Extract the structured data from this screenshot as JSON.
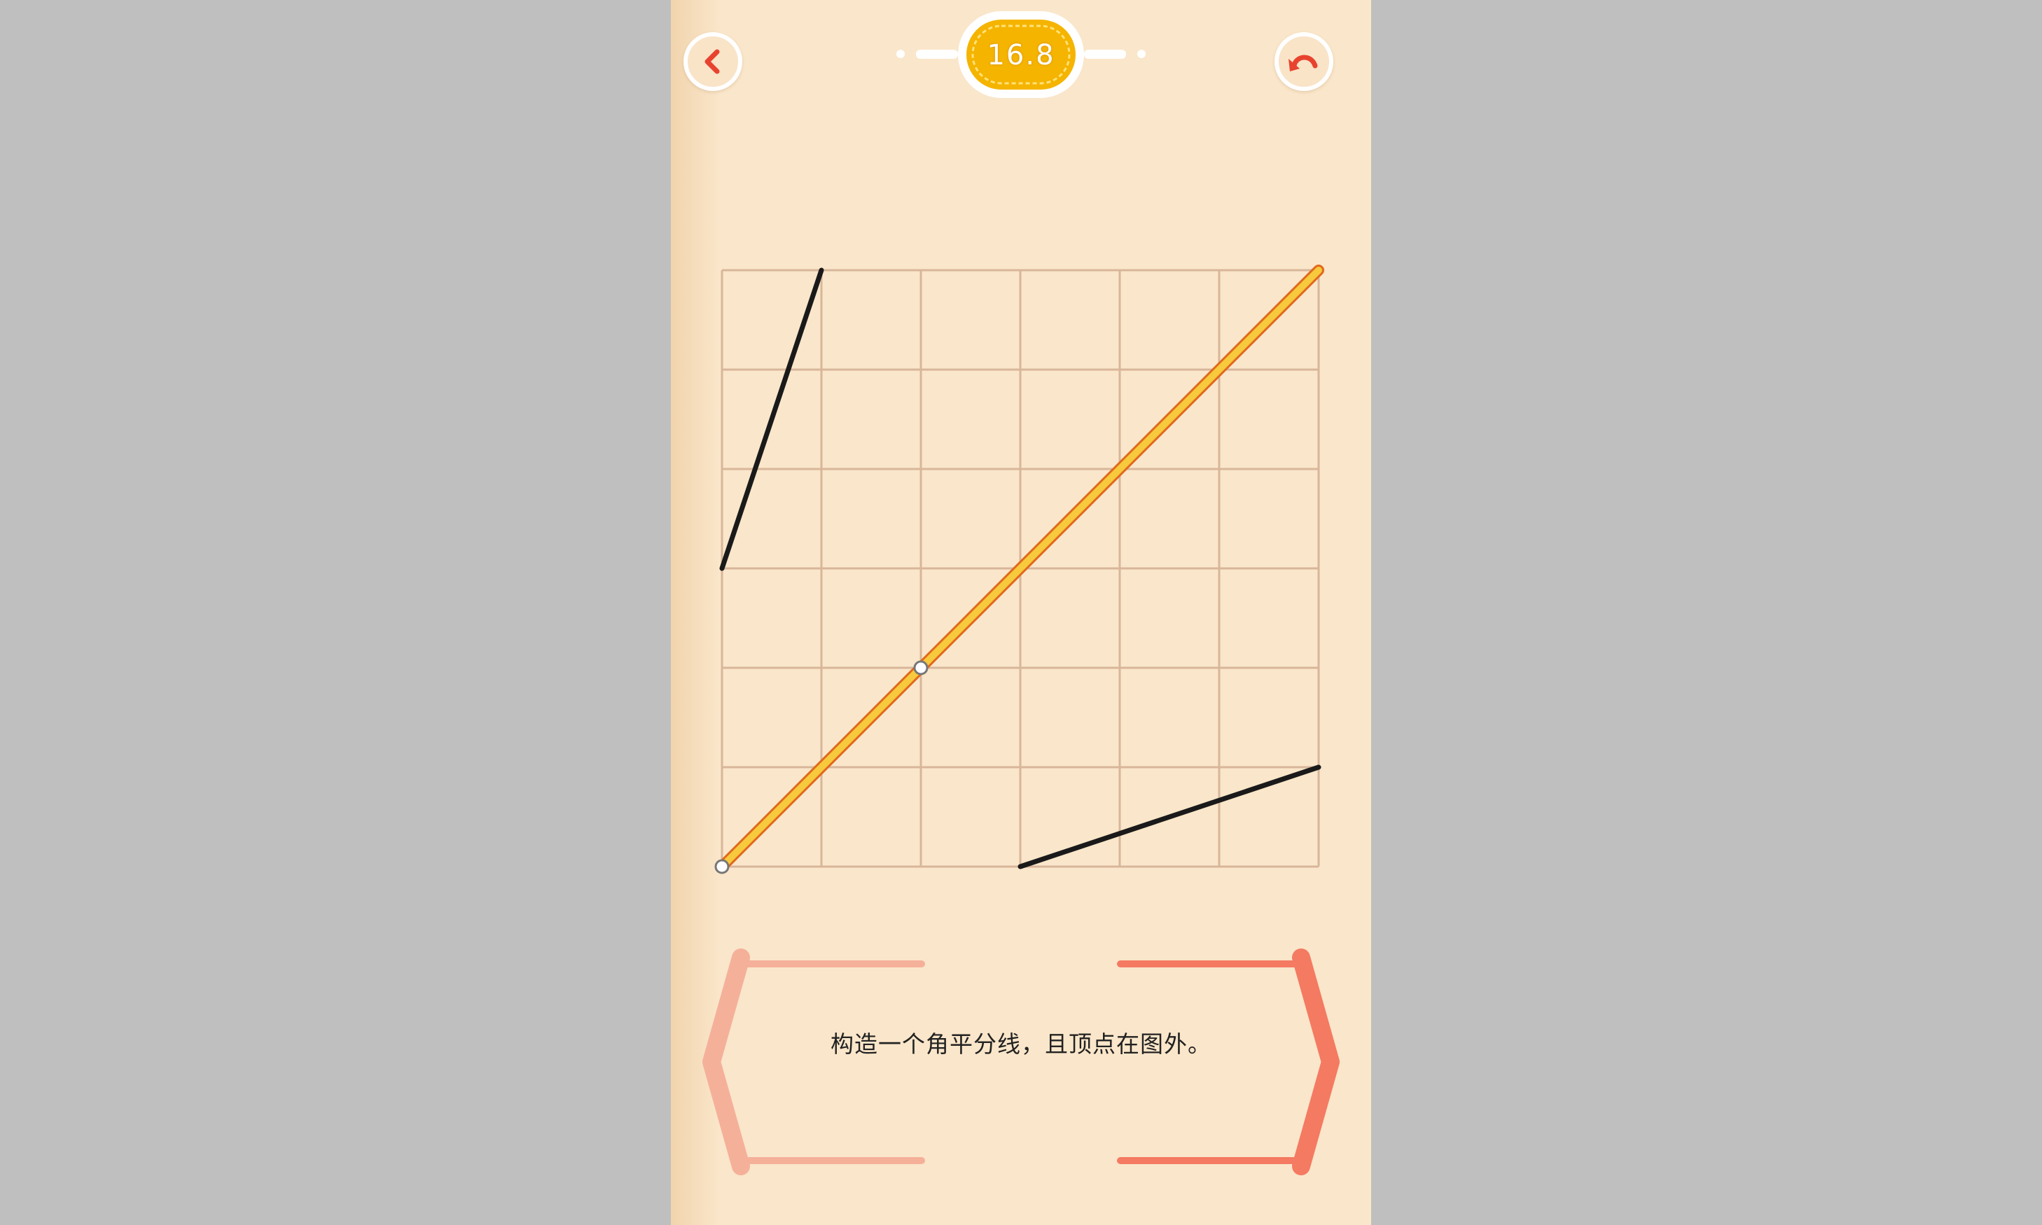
{
  "header": {
    "level": "16.8",
    "back_icon": "chevron-left-icon",
    "undo_icon": "undo-arrow-icon"
  },
  "colors": {
    "background": "#fae6ca",
    "grid": "#d8b69a",
    "segment": "#1a1a1a",
    "ruler_fill": "#f7c93c",
    "ruler_border": "#e0691c",
    "accent_icon": "#e8432f",
    "hint_left": "#f5b09a",
    "hint_right": "#f47a62"
  },
  "puzzle": {
    "grid_cells": 6,
    "segments": [
      {
        "from": [
          0,
          3
        ],
        "to": [
          1,
          6
        ]
      },
      {
        "from": [
          3,
          0
        ],
        "to": [
          6,
          1
        ]
      }
    ],
    "ruler": {
      "from": [
        0,
        0
      ],
      "to": [
        6,
        6
      ]
    },
    "handles": [
      [
        0,
        0
      ],
      [
        2,
        2
      ]
    ]
  },
  "hint": {
    "text": "构造一个角平分线，且顶点在图外。"
  }
}
